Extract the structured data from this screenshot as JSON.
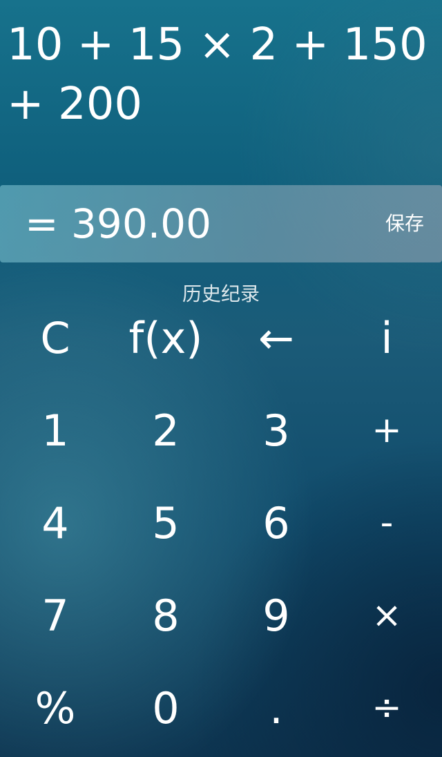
{
  "display": {
    "expression": "10 + 15 × 2 + 150 + 200",
    "result": "= 390.00",
    "save_label": "保存",
    "history_label": "历史纪录"
  },
  "keypad": {
    "clear": "C",
    "function": "f(x)",
    "backspace": "←",
    "info": "i",
    "one": "1",
    "two": "2",
    "three": "3",
    "plus": "+",
    "four": "4",
    "five": "5",
    "six": "6",
    "minus": "-",
    "seven": "7",
    "eight": "8",
    "nine": "9",
    "multiply": "×",
    "percent": "%",
    "zero": "0",
    "decimal": ".",
    "divide": "÷"
  }
}
